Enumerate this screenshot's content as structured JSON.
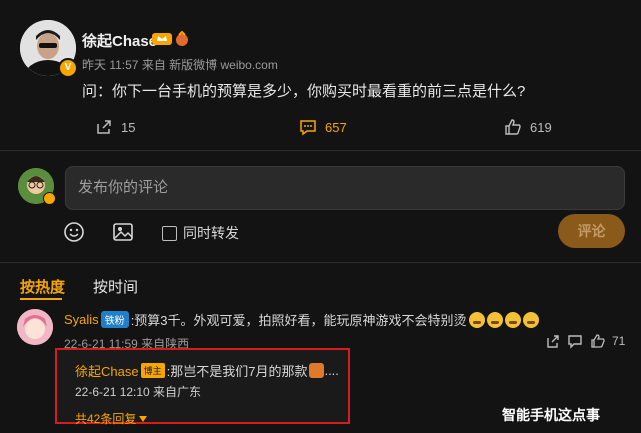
{
  "post": {
    "username": "徐起Chase",
    "avatar_badge": "V",
    "time": "昨天 11:57",
    "source": "来自 新版微博 weibo.com",
    "text": "问：你下一台手机的预算是多少，你购买时最看重的前三点是什么?",
    "actions": {
      "share_count": "15",
      "comment_count": "657",
      "like_count": "619"
    }
  },
  "composer": {
    "placeholder": "发布你的评论",
    "repost_label": "同时转发",
    "submit_label": "评论"
  },
  "tabs": {
    "hot": "按热度",
    "time": "按时间"
  },
  "comment": {
    "username": "Syalis",
    "fan_badge": "铁粉",
    "text": ":预算3千。外观可爱，拍照好看，能玩原神游戏不会特别烫",
    "time_location": "22-6-21 11:59 来自陕西",
    "like_count": "71",
    "reply": {
      "username": "徐起Chase",
      "tag": "博主",
      "text": ":那岂不是我们7月的那款",
      "suffix": "....",
      "time_location": "22-6-21 12:10 来自广东",
      "more_label": "共42条回复"
    }
  },
  "watermark": "智能手机这点事",
  "colors": {
    "background": "#131313",
    "accent": "#f7a600",
    "highlight_border": "#d81b1b"
  }
}
